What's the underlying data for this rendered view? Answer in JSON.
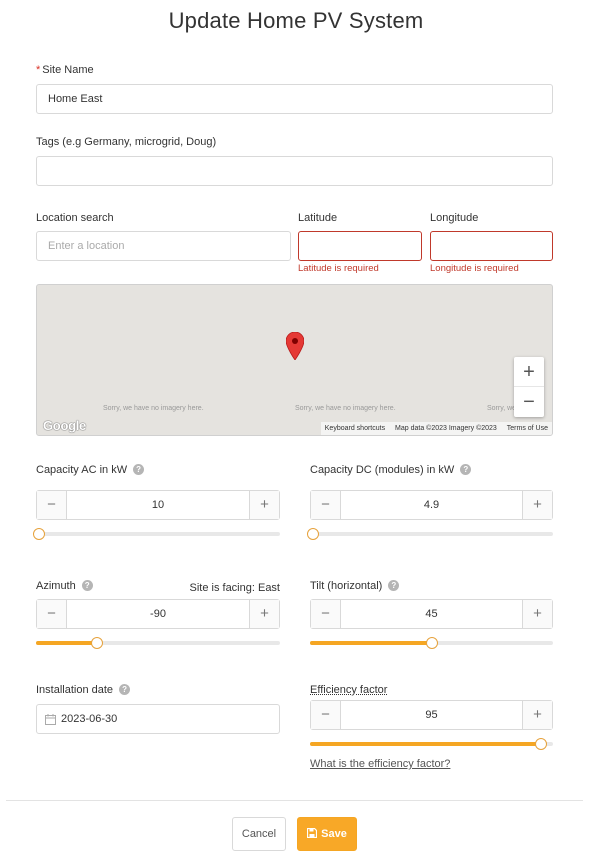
{
  "page": {
    "title": "Update Home PV System"
  },
  "site_name": {
    "required_mark": "*",
    "label": "Site Name",
    "value": "Home East"
  },
  "tags": {
    "label": "Tags (e.g Germany, microgrid, Doug)",
    "value": ""
  },
  "location": {
    "label": "Location search",
    "placeholder": "Enter a location"
  },
  "latitude": {
    "label": "Latitude",
    "value": "",
    "error": "Latitude is required"
  },
  "longitude": {
    "label": "Longitude",
    "value": "",
    "error": "Longitude is required"
  },
  "map": {
    "no_imagery": "Sorry, we have no imagery here.",
    "no_imagery_cut": "Sorry, we",
    "google_logo": "Google",
    "keyboard_shortcuts": "Keyboard shortcuts",
    "map_data": "Map data ©2023 Imagery ©2023",
    "terms": "Terms of Use",
    "zoom_in": "+",
    "zoom_out": "−",
    "pin_color": "#e53935"
  },
  "capacity_ac": {
    "label": "Capacity AC in kW",
    "value": "10",
    "slider_pct": 0
  },
  "capacity_dc": {
    "label": "Capacity DC (modules) in kW",
    "value": "4.9",
    "slider_pct": 0
  },
  "azimuth": {
    "label": "Azimuth",
    "facing": "Site is facing: East",
    "value": "-90",
    "slider_pct": 25
  },
  "tilt": {
    "label": "Tilt (horizontal)",
    "value": "45",
    "slider_pct": 50
  },
  "installation_date": {
    "label": "Installation date",
    "value": "2023-06-30"
  },
  "efficiency": {
    "label": "Efficiency factor",
    "value": "95",
    "slider_pct": 95,
    "link": "What is the efficiency factor?"
  },
  "stepper": {
    "minus": "−",
    "plus": "+"
  },
  "help_icon": "?",
  "buttons": {
    "cancel": "Cancel",
    "save": "Save"
  },
  "colors": {
    "accent": "#f8a827",
    "error": "#c0392b"
  }
}
